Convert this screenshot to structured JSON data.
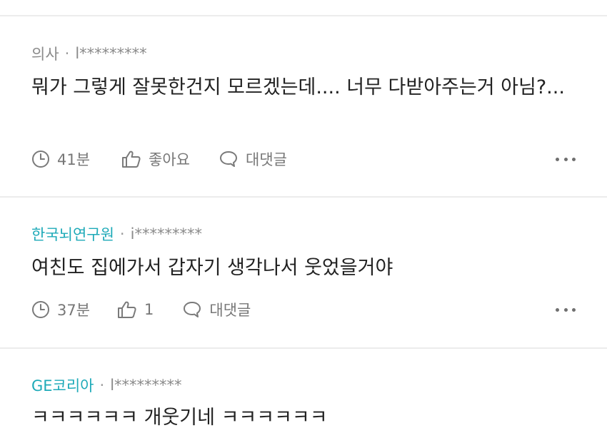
{
  "comments": [
    {
      "author": "의사",
      "separator": "·",
      "user_id": "l*********",
      "body": "뭐가 그렇게 잘못한건지 모르겠는데.... 너무 다받아주는거 아님?...",
      "time": "41분",
      "like_label": "좋아요",
      "reply_label": "대댓글"
    },
    {
      "author": "한국뇌연구원",
      "separator": "·",
      "user_id": "i*********",
      "body": "여친도 집에가서 갑자기 생각나서 웃었을거야",
      "time": "37분",
      "like_label": "1",
      "reply_label": "대댓글"
    },
    {
      "author": "GE코리아",
      "separator": "·",
      "user_id": "l*********",
      "body": "ㅋㅋㅋㅋㅋㅋ 개웃기네 ㅋㅋㅋㅋㅋㅋ"
    }
  ],
  "colors": {
    "verified_author": "#1eaab8",
    "meta_text": "#8a8a8a",
    "body_text": "#222222",
    "divider": "#ececec"
  },
  "icons": {
    "time": "clock-icon",
    "like": "thumbs-up-icon",
    "reply": "speech-bubble-icon",
    "more": "more-dots-icon"
  }
}
